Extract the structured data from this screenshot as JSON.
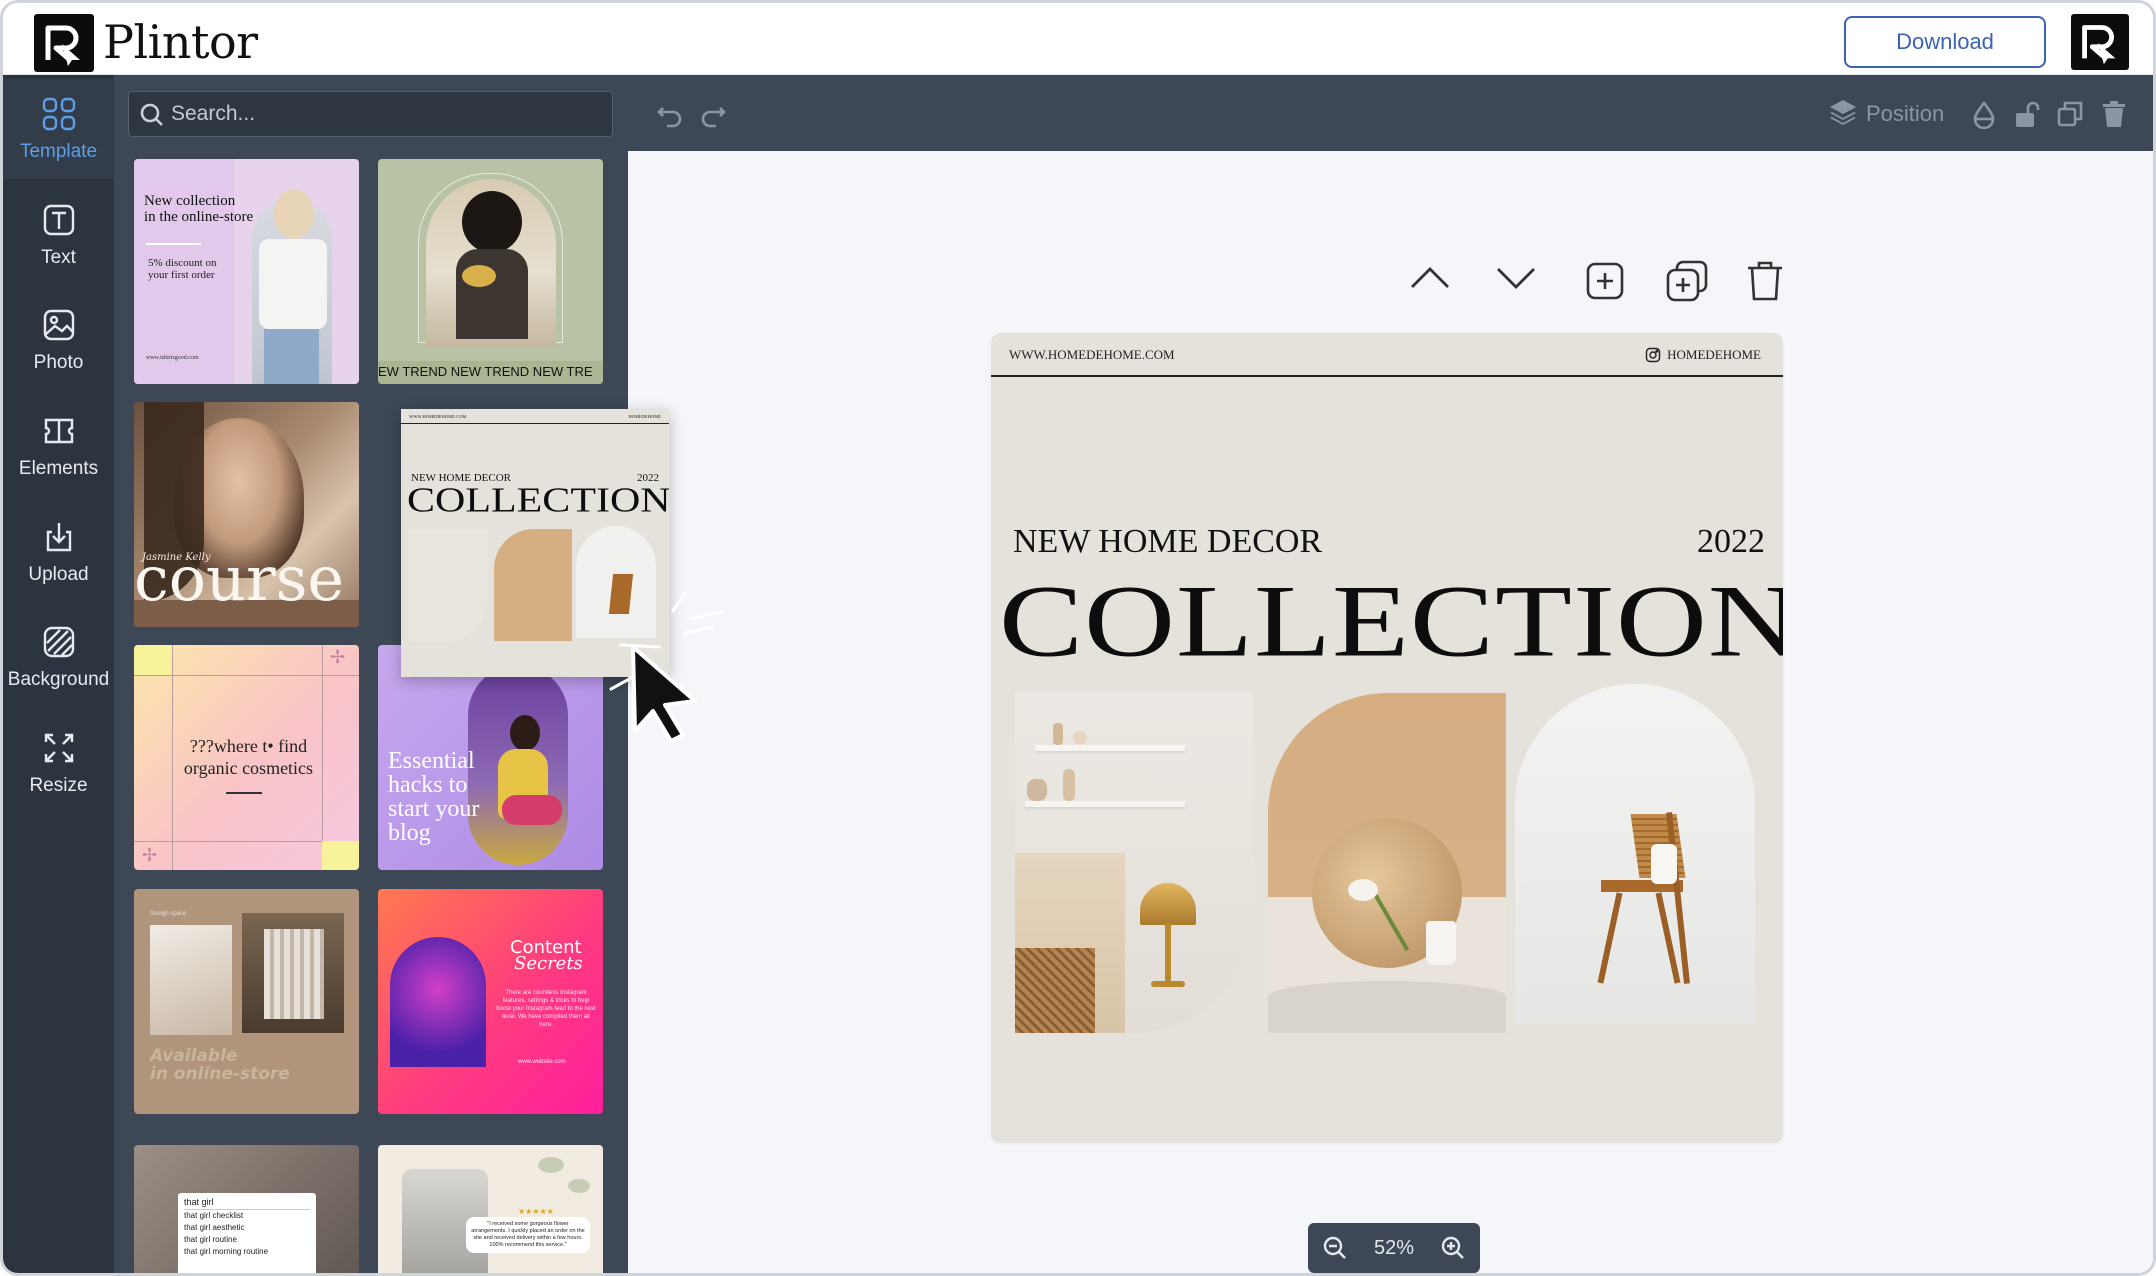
{
  "app": {
    "name": "Plintor"
  },
  "header": {
    "download_label": "Download"
  },
  "rail": {
    "items": [
      {
        "label": "Template",
        "icon": "template-grid-icon",
        "active": true
      },
      {
        "label": "Text",
        "icon": "text-icon"
      },
      {
        "label": "Photo",
        "icon": "photo-icon"
      },
      {
        "label": "Elements",
        "icon": "elements-icon"
      },
      {
        "label": "Upload",
        "icon": "upload-icon"
      },
      {
        "label": "Background",
        "icon": "background-icon"
      },
      {
        "label": "Resize",
        "icon": "resize-icon"
      }
    ]
  },
  "search": {
    "placeholder": "Search..."
  },
  "templates": {
    "t1": {
      "title": "New collection\nin the online-store",
      "sub": "5% discount on\nyour first order",
      "url": "www.tshirtsgood.com"
    },
    "t2": {
      "ticker": "EW TREND NEW TREND NEW TRE"
    },
    "t3": {
      "script": "Jasmine Kelly",
      "big": "course"
    },
    "t5": {
      "text": "???where t• find\norganic cosmetics"
    },
    "t6": {
      "text": "Essential\nhacks to\nstart your\nblog"
    },
    "t7": {
      "text": "Available\nin online-store",
      "small": "Design space"
    },
    "t8": {
      "title": "Content",
      "title2": "Secrets",
      "body": "There are countless Instagram features, settings & tricks to help boost your Instagram feed to the next level. We have compiled them all here.",
      "url": "www.website.com"
    },
    "t9": {
      "query": "that girl",
      "suggestions": [
        "that girl checklist",
        "that girl aesthetic",
        "that girl routine",
        "that girl morning routine"
      ]
    },
    "t10": {
      "quote": "\"I received some gorgeous flower arrangements. I quickly placed an order on the site and received delivery within a few hours. 100% recommend this service.\"",
      "stars": "★★★★★"
    }
  },
  "drag_preview": {
    "url": "WWW.HOMEDEHOME.COM",
    "ig": "HOMEDEHOME",
    "sub": "NEW HOME DECOR",
    "year": "2022",
    "title": "COLLECTION"
  },
  "toolbar": {
    "position_label": "Position"
  },
  "design": {
    "url": "WWW.HOMEDEHOME.COM",
    "ig": "HOMEDEHOME",
    "sub": "NEW HOME DECOR",
    "year": "2022",
    "title": "COLLECTION"
  },
  "zoom": {
    "level": "52%"
  },
  "colors": {
    "accent": "#5c9fe8",
    "rail": "#2c3440",
    "panel": "#3d4756",
    "download": "#3b63b5"
  }
}
